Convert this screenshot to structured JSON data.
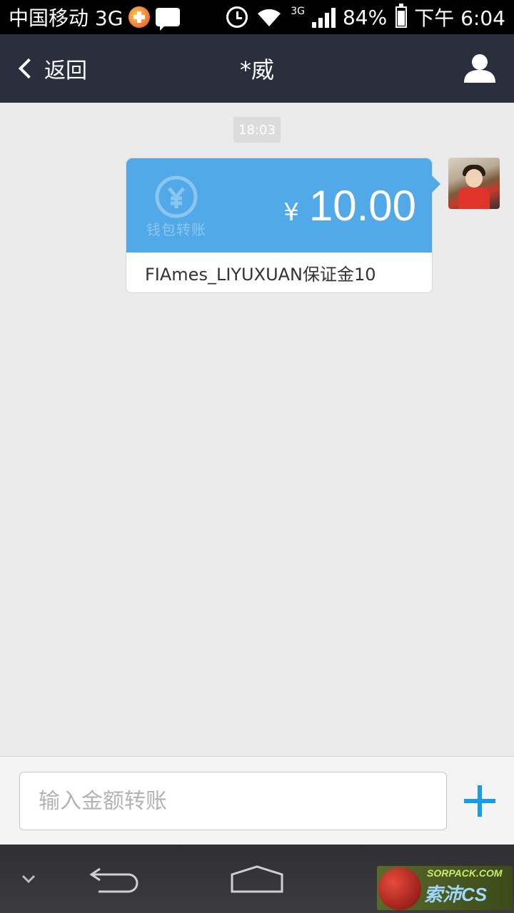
{
  "status_bar": {
    "carrier": "中国移动 3G",
    "network_type": "3G",
    "battery": "84%",
    "time": "下午 6:04"
  },
  "nav": {
    "back_label": "返回",
    "title": "*威"
  },
  "chat": {
    "timestamp": "18:03",
    "transfer": {
      "wallet_label": "钱包转账",
      "currency_symbol": "¥",
      "amount": "10.00",
      "note": "FIAmes_LIYUXUAN保证金10"
    }
  },
  "input": {
    "placeholder": "输入金额转账"
  },
  "watermark": {
    "top_text": "SORPACK.COM",
    "main_text": "索沛CS"
  },
  "colors": {
    "nav_bg": "#2a2e3d",
    "transfer_blue": "#52a9e8",
    "accent_plus": "#1a9be6",
    "chat_bg": "#ebebeb"
  }
}
